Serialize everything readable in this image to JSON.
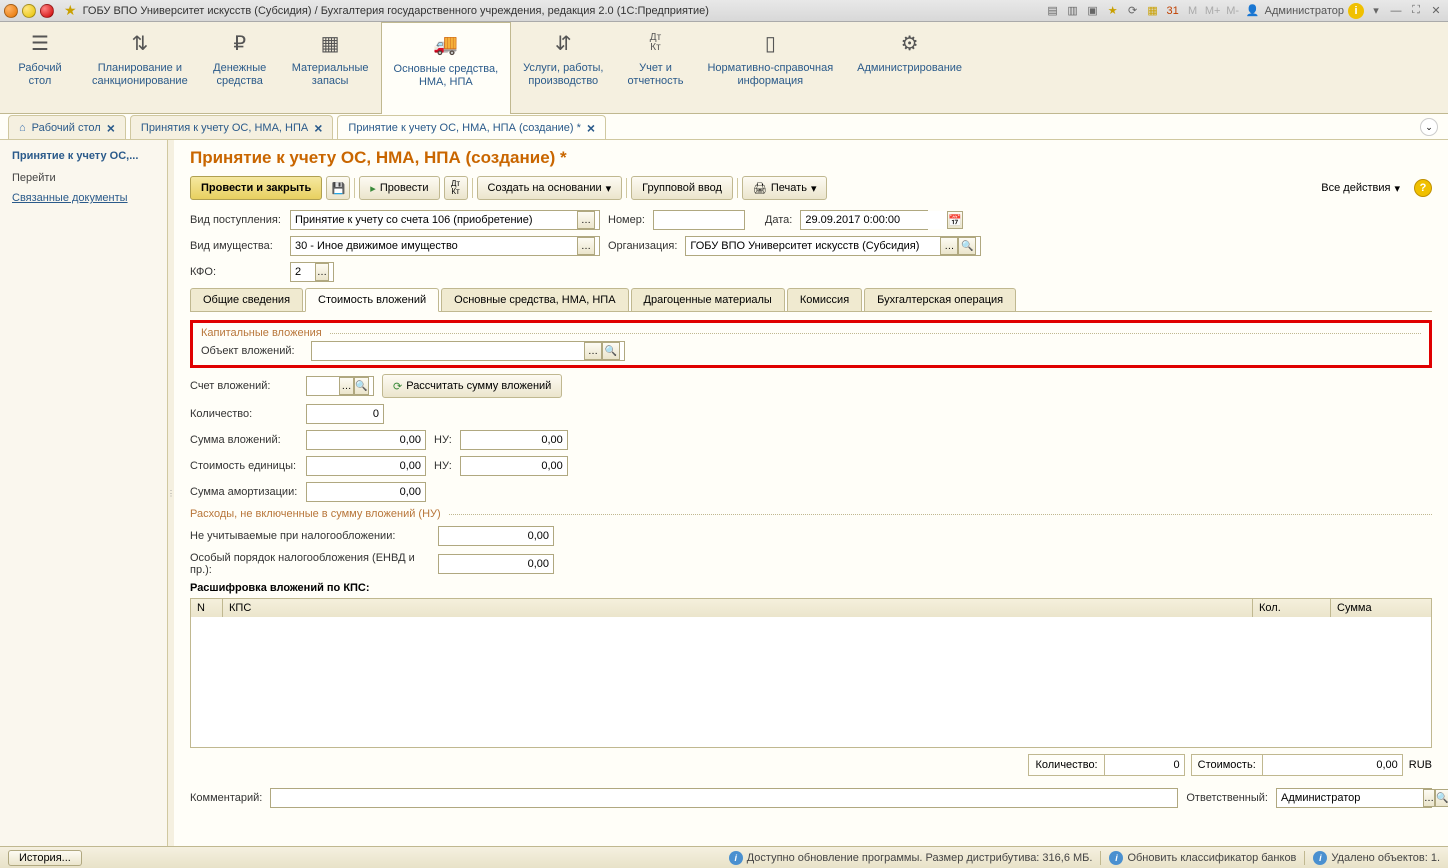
{
  "window": {
    "title": "ГОБУ ВПО Университет искусств (Субсидия) / Бухгалтерия государственного учреждения, редакция 2.0  (1С:Предприятие)",
    "user_label": "Администратор",
    "m1": "M",
    "m2": "M+",
    "m3": "M-"
  },
  "ribbon": [
    {
      "label": "Рабочий\nстол",
      "icon": "☰"
    },
    {
      "label": "Планирование и\nсанкционирование",
      "icon": "⇅"
    },
    {
      "label": "Денежные\nсредства",
      "icon": "₽"
    },
    {
      "label": "Материальные\nзапасы",
      "icon": "▦"
    },
    {
      "label": "Основные средства,\nНМА, НПА",
      "icon": "🚚"
    },
    {
      "label": "Услуги, работы,\nпроизводство",
      "icon": "⇵"
    },
    {
      "label": "Учет и\nотчетность",
      "icon": "Дт\nКт"
    },
    {
      "label": "Нормативно-справочная\nинформация",
      "icon": "▯"
    },
    {
      "label": "Администрирование",
      "icon": "⚙"
    }
  ],
  "tabs": [
    {
      "label": "Рабочий стол"
    },
    {
      "label": "Принятия к учету ОС, НМА, НПА"
    },
    {
      "label": "Принятие к учету ОС, НМА, НПА (создание) *"
    }
  ],
  "tab_expand": "⌄",
  "sidebar": {
    "title": "Принятие к учету ОС,...",
    "go": "Перейти",
    "link1": "Связанные документы"
  },
  "page": {
    "title": "Принятие к учету ОС, НМА, НПА (создание) *",
    "toolbar": {
      "save_close": "Провести и закрыть",
      "post": "Провести",
      "create_based": "Создать на основании",
      "group_input": "Групповой ввод",
      "print": "Печать",
      "all_actions": "Все действия"
    },
    "form": {
      "receipt_type_l": "Вид поступления:",
      "receipt_type": "Принятие к учету со счета 106 (приобретение)",
      "number_l": "Номер:",
      "number": "",
      "date_l": "Дата:",
      "date": "29.09.2017 0:00:00",
      "asset_type_l": "Вид имущества:",
      "asset_type": "30 - Иное движимое имущество",
      "org_l": "Организация:",
      "org": "ГОБУ ВПО Университет искусств (Субсидия)",
      "kfo_l": "КФО:",
      "kfo": "2"
    },
    "inner_tabs": [
      "Общие сведения",
      "Стоимость вложений",
      "Основные средства, НМА, НПА",
      "Драгоценные материалы",
      "Комиссия",
      "Бухгалтерская операция"
    ],
    "invest": {
      "legend": "Капитальные вложения",
      "object_l": "Объект вложений:",
      "object": "",
      "account_l": "Счет вложений:",
      "account": "",
      "recalc": "Рассчитать сумму вложений",
      "qty_l": "Количество:",
      "qty": "0",
      "sum_l": "Сумма вложений:",
      "sum": "0,00",
      "nu_l": "НУ:",
      "nu1": "0,00",
      "unit_cost_l": "Стоимость единицы:",
      "unit_cost": "0,00",
      "nu2": "0,00",
      "amort_l": "Сумма амортизации:",
      "amort": "0,00"
    },
    "expenses": {
      "legend": "Расходы, не включенные в сумму вложений (НУ)",
      "nontax_l": "Не учитываемые при налогообложении:",
      "nontax": "0,00",
      "special_l": "Особый порядок налогообложения (ЕНВД и пр.):",
      "special": "0,00"
    },
    "kps": {
      "title": "Расшифровка вложений по КПС:",
      "col_n": "N",
      "col_kps": "КПС",
      "col_qty": "Кол.",
      "col_sum": "Сумма"
    },
    "footer": {
      "qty_l": "Количество:",
      "qty": "0",
      "cost_l": "Стоимость:",
      "cost": "0,00",
      "cur": "RUB"
    },
    "comment_l": "Комментарий:",
    "comment": "",
    "resp_l": "Ответственный:",
    "resp": "Администратор"
  },
  "status": {
    "history": "История...",
    "update": "Доступно обновление программы. Размер дистрибутива: 316,6 МБ.",
    "bank": "Обновить классификатор банков",
    "deleted": "Удалено объектов: 1."
  }
}
